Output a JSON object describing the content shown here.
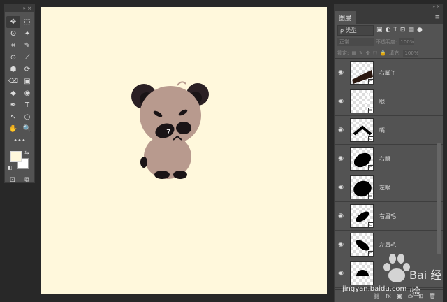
{
  "tools": {
    "icons": [
      "move-icon",
      "marquee-icon",
      "lasso-icon",
      "magic-wand-icon",
      "crop-icon",
      "eyedropper-icon",
      "spot-heal-icon",
      "brush-icon",
      "stamp-icon",
      "history-brush-icon",
      "eraser-icon",
      "gradient-icon",
      "blur-icon",
      "dodge-icon",
      "pen-icon",
      "type-icon",
      "path-select-icon",
      "ellipse-icon",
      "hand-icon",
      "zoom-icon"
    ],
    "glyphs": [
      "✥",
      "⬚",
      "ʘ",
      "✦",
      "⌗",
      "✎",
      "⊙",
      "⟋",
      "⬢",
      "⟳",
      "⌫",
      "▣",
      "◆",
      "◉",
      "✒",
      "T",
      "↖",
      "○",
      "✋",
      "🔍"
    ],
    "more": "•••",
    "fg_color": "#fff8dc",
    "bg_color": "#ffffff"
  },
  "canvas": {
    "background": "#fff8dc"
  },
  "layers_panel": {
    "tab_label": "图层",
    "filter_label": "ρ 类型",
    "blend_mode": "正常",
    "opacity_label": "不透明度:",
    "opacity_value": "100%",
    "lock_label": "锁定:",
    "fill_label": "填充:",
    "fill_value": "100%",
    "layers": [
      {
        "name": "右脚丫"
      },
      {
        "name": "眼"
      },
      {
        "name": "嘴"
      },
      {
        "name": "右眼"
      },
      {
        "name": "左眼"
      },
      {
        "name": "右眉毛"
      },
      {
        "name": "左眉毛"
      },
      {
        "name": ""
      }
    ]
  },
  "watermark": {
    "text": "Bai 经验",
    "url": "jingyan.baidu.com"
  }
}
